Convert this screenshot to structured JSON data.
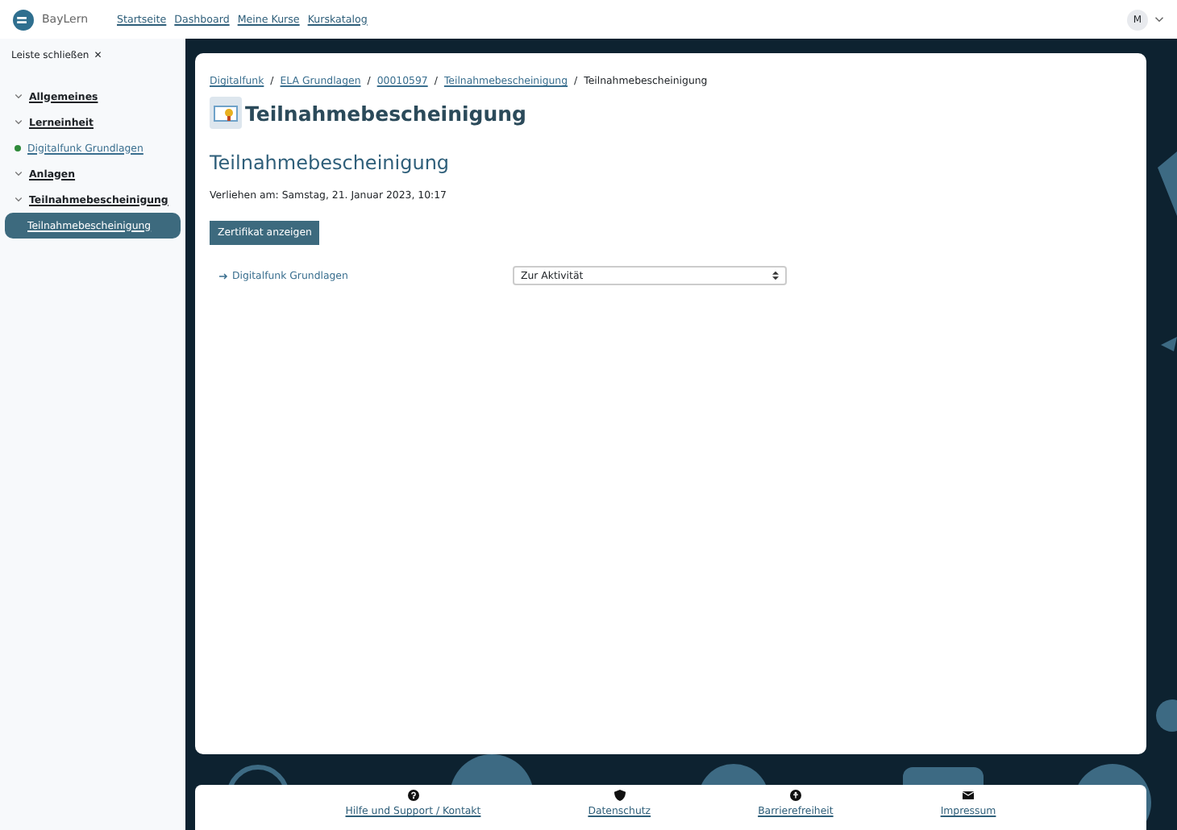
{
  "brand": "BayLern",
  "nav": [
    {
      "label": "Startseite"
    },
    {
      "label": "Dashboard"
    },
    {
      "label": "Meine Kurse"
    },
    {
      "label": "Kurskatalog"
    }
  ],
  "user": {
    "initial": "M"
  },
  "sidebar": {
    "close_label": "Leiste schließen",
    "close_icon": "✕",
    "items": [
      {
        "kind": "section",
        "label": "Allgemeines",
        "selected": false
      },
      {
        "kind": "section",
        "label": "Lerneinheit",
        "selected": false
      },
      {
        "kind": "activity",
        "label": "Digitalfunk Grundlagen",
        "selected": false
      },
      {
        "kind": "section",
        "label": "Anlagen",
        "selected": false
      },
      {
        "kind": "section",
        "label": "Teilnahmebescheinigung",
        "selected": false
      },
      {
        "kind": "activity",
        "label": "Teilnahmebescheinigung",
        "selected": true
      }
    ]
  },
  "breadcrumb_separator": "/",
  "breadcrumb": [
    {
      "label": "Digitalfunk",
      "link": true
    },
    {
      "label": "ELA Grundlagen",
      "link": true
    },
    {
      "label": "00010597",
      "link": true
    },
    {
      "label": "Teilnahmebescheinigung",
      "link": true
    },
    {
      "label": "Teilnahmebescheinigung",
      "link": false
    }
  ],
  "page_title": "Teilnahmebescheinigung",
  "heading": "Teilnahmebescheinigung",
  "awarded": "Verliehen am: Samstag, 21. Januar 2023, 10:17",
  "button": "Zertifikat anzeigen",
  "prev_link": "Digitalfunk Grundlagen",
  "jump_select": {
    "value": "Zur Aktivität"
  },
  "footer": [
    {
      "kind": "help",
      "label": "Hilfe und Support / Kontakt"
    },
    {
      "kind": "privacy",
      "label": "Datenschutz"
    },
    {
      "kind": "accessibility",
      "label": "Barrierefreiheit"
    },
    {
      "kind": "mail",
      "label": "Impressum"
    }
  ]
}
